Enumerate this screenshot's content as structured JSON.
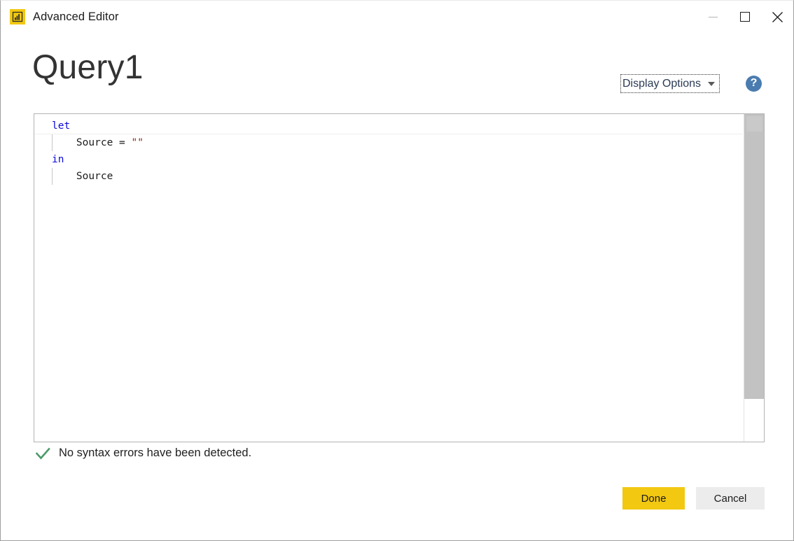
{
  "window": {
    "titlebar": {
      "app_icon": "powerbi-bar-chart-icon",
      "title": "Advanced Editor",
      "controls": {
        "minimize": "minimize-icon",
        "maximize": "maximize-icon",
        "close": "close-icon"
      }
    },
    "header": {
      "page_title": "Query1",
      "display_options_label": "Display Options",
      "display_options_caret": "chevron-down-icon",
      "help_label": "?"
    },
    "editor": {
      "lines": [
        {
          "indent": 0,
          "tokens": [
            {
              "text": "let",
              "type": "keyword"
            }
          ]
        },
        {
          "indent": 1,
          "tokens": [
            {
              "text": "Source = ",
              "type": "plain"
            },
            {
              "text": "\"\"",
              "type": "string"
            }
          ]
        },
        {
          "indent": 0,
          "tokens": [
            {
              "text": "in",
              "type": "keyword"
            }
          ]
        },
        {
          "indent": 1,
          "tokens": [
            {
              "text": "Source",
              "type": "plain"
            }
          ]
        }
      ],
      "line_texts": {
        "l1": "let",
        "l2_plain": "Source = ",
        "l2_string": "\"\"",
        "l3": "in",
        "l4": "Source"
      },
      "scrollbar": "vertical-scrollbar"
    },
    "status": {
      "icon": "checkmark-icon",
      "message": "No syntax errors have been detected."
    },
    "footer": {
      "done_label": "Done",
      "cancel_label": "Cancel"
    }
  },
  "colors": {
    "brand_yellow": "#f2c811",
    "keyword_blue": "#0b09db",
    "string_maroon": "#8b2a19",
    "check_green": "#4c9a6b",
    "help_blue": "#4a7cb0",
    "cancel_gray": "#ececec"
  }
}
